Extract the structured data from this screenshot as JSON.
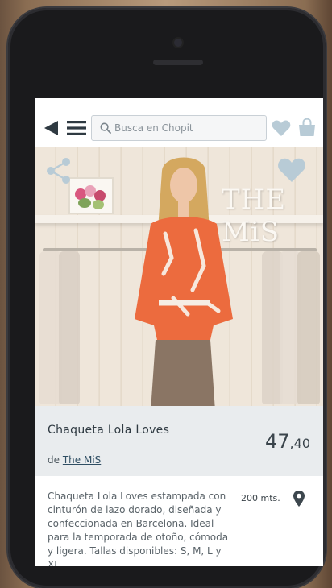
{
  "search": {
    "placeholder": "Busca en Chopit"
  },
  "image": {
    "sign_text": "THE MiS"
  },
  "product": {
    "title": "Chaqueta Lola Loves",
    "price_integer": "47",
    "price_decimal": ",40",
    "brand_prefix": "de",
    "brand_name": "The MiS",
    "description": "Chaqueta Lola Loves estampada con cinturón de lazo dorado, diseñada y confeccionada en Barcelona. Ideal para la temporada de otoño, cómoda y ligera. Tallas disponibles: S, M, L y XL.",
    "distance": "200 mts."
  },
  "icons": {
    "back": "back-triangle-icon",
    "menu": "hamburger-menu-icon",
    "search": "search-icon",
    "favorite": "heart-icon",
    "bag": "shopping-bag-icon",
    "share": "share-icon",
    "location": "location-pin-icon"
  },
  "colors": {
    "accent": "#2f4e63",
    "icon_light": "#b8cbd6",
    "info_background": "#e9ecee"
  }
}
